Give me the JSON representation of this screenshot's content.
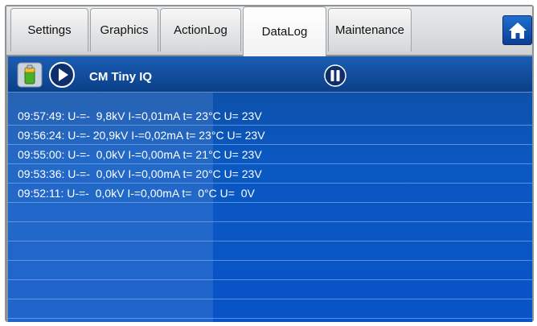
{
  "tabs": [
    {
      "label": "Settings",
      "active": false
    },
    {
      "label": "Graphics",
      "active": false
    },
    {
      "label": "ActionLog",
      "active": false
    },
    {
      "label": "DataLog",
      "active": true
    },
    {
      "label": "Maintenance",
      "active": false
    }
  ],
  "home_icon": "home-icon",
  "toolbar": {
    "device_icon": "battery-device-icon",
    "play_icon": "play-icon",
    "device_name": "CM Tiny IQ",
    "pause_icon": "pause-icon"
  },
  "log_entries": [
    "09:57:49: U-=-  9,8kV I-=0,01mA t= 23°C U= 23V",
    "09:56:24: U-=- 20,9kV I-=0,02mA t= 23°C U= 23V",
    "09:55:00: U-=-  0,0kV I-=0,00mA t= 21°C U= 23V",
    "09:53:36: U-=-  0,0kV I-=0,00mA t= 20°C U= 23V",
    "09:52:11: U-=-  0,0kV I-=0,00mA t=  0°C U=  0V"
  ],
  "colors": {
    "panel_blue": "#0a58c2",
    "toolbar_blue": "#0b3f88",
    "tab_active": "#ffffff"
  }
}
